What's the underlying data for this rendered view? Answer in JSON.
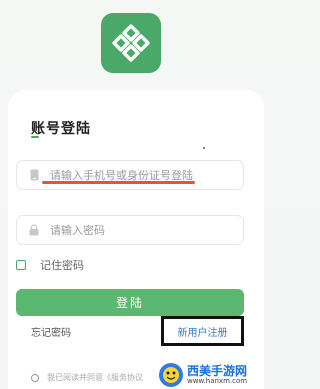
{
  "login": {
    "title": "账号登陆",
    "phone_placeholder": "请输入手机号或身份证号登陆",
    "password_placeholder": "请输入密码",
    "remember_label": "记住密码",
    "submit_label": "登陆",
    "forgot_label": "忘记密码",
    "register_label": "新用户注册",
    "agreement_text": "我已阅读并同意《服务协议"
  },
  "icons": {
    "logo": "app-logo",
    "phone": "phone-icon",
    "password": "lock-icon"
  },
  "watermark": {
    "name": "西美手游网",
    "url": "www.hanxm.com"
  },
  "colors": {
    "brand": "#4aa968",
    "button": "#5bb871",
    "link": "#2f7fd6",
    "highlight": "#e5533a"
  }
}
